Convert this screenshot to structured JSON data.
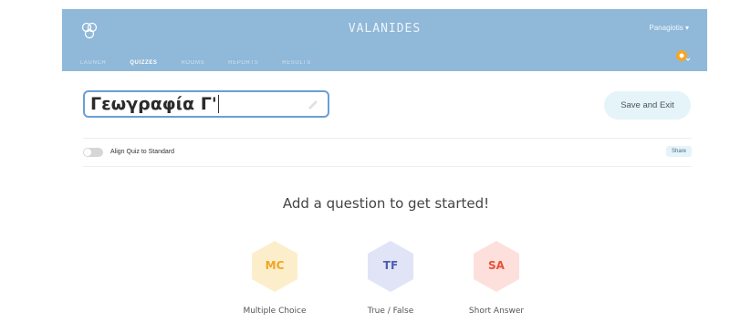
{
  "header": {
    "brand": "VALANIDES",
    "user_name": "Panagiotis ▾",
    "nav": [
      {
        "label": "LAUNCH",
        "active": false
      },
      {
        "label": "QUIZZES",
        "active": true
      },
      {
        "label": "ROOMS",
        "active": false
      },
      {
        "label": "REPORTS",
        "active": false
      },
      {
        "label": "RESULTS",
        "active": false
      }
    ]
  },
  "quiz": {
    "title": "Γεωγραφία Γ'"
  },
  "toolbar": {
    "save_label": "Save and Exit",
    "align_label": "Align Quiz to Standard",
    "share_label": "Share"
  },
  "main": {
    "heading": "Add a question to get started!",
    "question_types": [
      {
        "abbr": "MC",
        "label": "Multiple Choice",
        "fill": "#fdeecb",
        "color": "#f2a520"
      },
      {
        "abbr": "TF",
        "label": "True / False",
        "fill": "#e1e4f6",
        "color": "#4b5fb0"
      },
      {
        "abbr": "SA",
        "label": "Short Answer",
        "fill": "#fde0dc",
        "color": "#e8503a"
      }
    ]
  },
  "colors": {
    "header_bg": "#8fb8d9",
    "title_border": "#6a9fd4",
    "save_bg": "#e5f4f8"
  }
}
